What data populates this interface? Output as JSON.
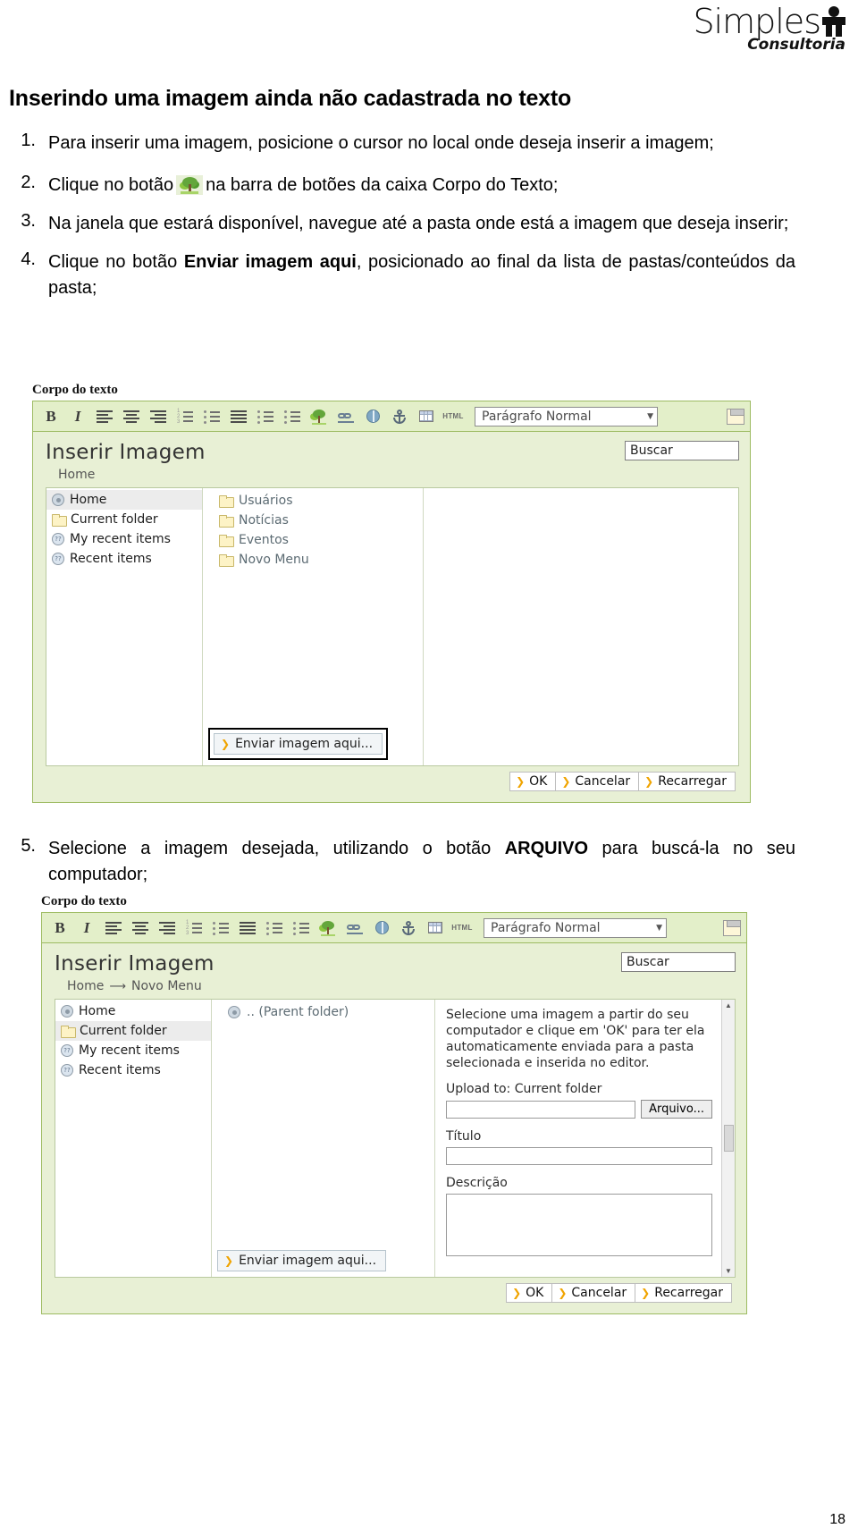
{
  "brand": {
    "name": "Simples",
    "sub": "Consultoria"
  },
  "document": {
    "title": "Inserindo uma imagem ainda não cadastrada no texto",
    "page_number": "18",
    "steps": [
      {
        "num": "1.",
        "text_before": "Para inserir uma imagem, posicione o cursor no local onde deseja inserir a imagem;",
        "text_after": ""
      },
      {
        "num": "2.",
        "text_before": "Clique no botão",
        "icon": "tree-image-icon",
        "text_after": "na barra de botões da caixa Corpo do Texto;"
      },
      {
        "num": "3.",
        "text_before": "Na janela que estará disponível, navegue até a pasta onde está a imagem que deseja inserir;",
        "text_after": ""
      },
      {
        "num": "4.",
        "text_before": "Clique no botão",
        "bold": "Enviar imagem aqui",
        "text_after": ", posicionado ao final da lista de pastas/conteúdos da pasta;"
      },
      {
        "num": "5.",
        "text_before": "Selecione a imagem desejada, utilizando o botão",
        "bold": "ARQUIVO",
        "text_after": "para buscá-la no seu computador;"
      }
    ]
  },
  "editor": {
    "label": "Corpo do texto",
    "toolbar": {
      "bold": "B",
      "italic": "I",
      "html": "HTML",
      "paragraph_style": "Parágrafo Normal",
      "caret": "▼",
      "icons": [
        "bold-icon",
        "italic-icon",
        "align-left-icon",
        "align-center-icon",
        "align-right-icon",
        "ordered-list-icon",
        "bullet-list-icon",
        "align-justify-icon",
        "outdent-icon",
        "indent-icon",
        "insert-image-icon",
        "insert-link-icon",
        "external-link-icon",
        "anchor-icon",
        "insert-table-icon",
        "html-source-icon",
        "save-icon"
      ]
    }
  },
  "screenshot1": {
    "dialog_title": "Inserir Imagem",
    "search_placeholder": "Buscar",
    "breadcrumb": [
      "Home"
    ],
    "sidebar": [
      {
        "label": "Home",
        "icon": "home-icon",
        "selected": true
      },
      {
        "label": "Current folder",
        "icon": "folder-icon",
        "selected": false
      },
      {
        "label": "My recent items",
        "icon": "recent-icon",
        "selected": false
      },
      {
        "label": "Recent items",
        "icon": "recent-icon",
        "selected": false
      }
    ],
    "folders": [
      "Usuários",
      "Notícias",
      "Eventos",
      "Novo Menu"
    ],
    "upload_button": "Enviar imagem aqui...",
    "footer_buttons": [
      "OK",
      "Cancelar",
      "Recarregar"
    ]
  },
  "screenshot2": {
    "dialog_title": "Inserir Imagem",
    "search_placeholder": "Buscar",
    "breadcrumb": [
      "Home",
      "Novo Menu"
    ],
    "breadcrumb_arrow": "⟶",
    "sidebar": [
      {
        "label": "Home",
        "icon": "home-icon",
        "selected": false
      },
      {
        "label": "Current folder",
        "icon": "folder-icon",
        "selected": true
      },
      {
        "label": "My recent items",
        "icon": "recent-icon",
        "selected": false
      },
      {
        "label": "Recent items",
        "icon": "recent-icon",
        "selected": false
      }
    ],
    "folders": [
      ".. (Parent folder)"
    ],
    "upload_button": "Enviar imagem aqui...",
    "info_text": "Selecione uma imagem a partir do seu computador e clique em 'OK' para ter ela automaticamente enviada para a pasta selecionada e inserida no editor.",
    "upload_to_label": "Upload to: Current folder",
    "file_button": "Arquivo...",
    "title_label": "Título",
    "description_label": "Descrição",
    "footer_buttons": [
      "OK",
      "Cancelar",
      "Recarregar"
    ]
  }
}
